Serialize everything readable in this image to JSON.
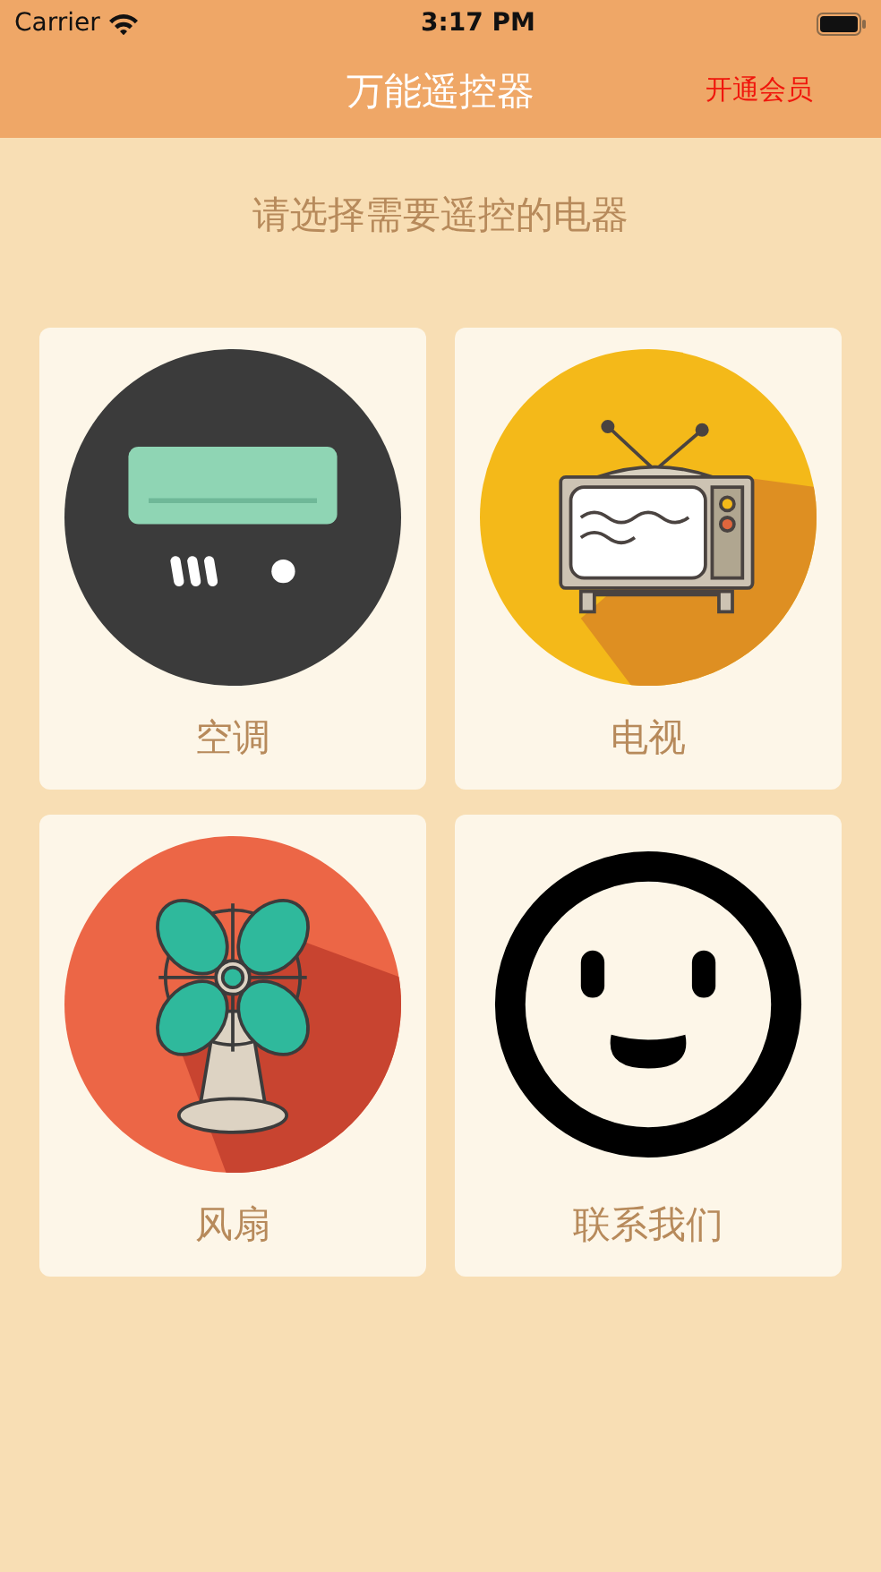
{
  "status_bar": {
    "carrier": "Carrier",
    "time": "3:17 PM"
  },
  "nav_bar": {
    "title": "万能遥控器",
    "action": "开通会员"
  },
  "prompt": "请选择需要遥控的电器",
  "devices": [
    {
      "kind": "air_conditioner",
      "label": "空调"
    },
    {
      "kind": "tv",
      "label": "电视"
    },
    {
      "kind": "fan",
      "label": "风扇"
    },
    {
      "kind": "contact",
      "label": "联系我们"
    }
  ]
}
